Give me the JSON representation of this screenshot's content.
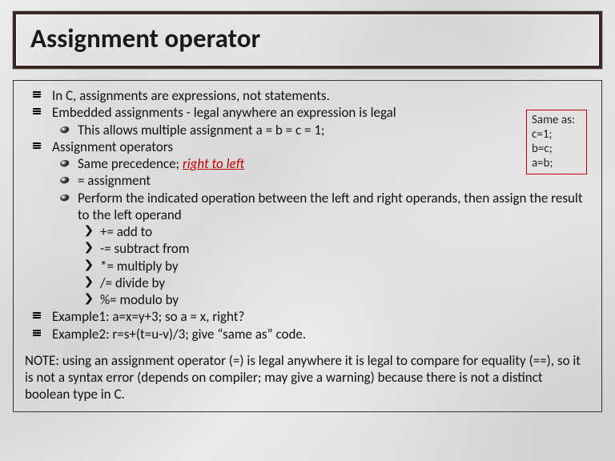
{
  "title": "Assignment operator",
  "bullets": {
    "b1": "In C, assignments are expressions, not statements.",
    "b2": "Embedded assignments - legal anywhere an expression is legal",
    "b2_1": "This allows multiple assignment a = b = c = 1;",
    "b3": "Assignment operators",
    "b3_1a": "Same precedence; ",
    "b3_1b": "right to left",
    "b3_2": "= assignment",
    "b3_3": "Perform the indicated operation between the left and right operands, then assign the result to the left operand",
    "b3_3_1": "+= add to",
    "b3_3_2": "-= subtract from",
    "b3_3_3": "*= multiply by",
    "b3_3_4": "/= divide by",
    "b3_3_5": "%= modulo by",
    "b4": "Example1: a=x=y+3; so a = x, right?",
    "b5": "Example2: r=s+(t=u-v)/3; give “same as” code."
  },
  "note": "NOTE: using an assignment operator (=) is legal anywhere it is legal to compare for equality (==), so it is not a syntax error (depends on compiler; may give a warning) because there is not a distinct boolean type in C.",
  "callout": {
    "l1": "Same as:",
    "l2": "c=1;",
    "l3": "b=c;",
    "l4": "a=b;"
  }
}
